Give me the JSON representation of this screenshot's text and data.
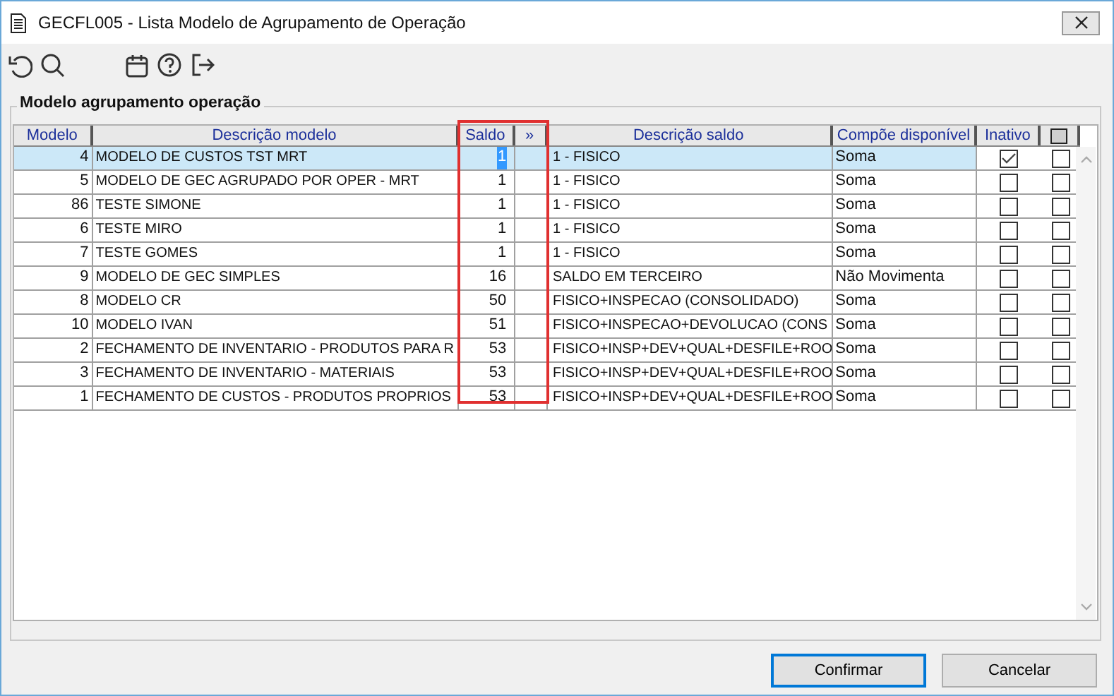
{
  "window": {
    "title": "GECFL005 - Lista Modelo de Agrupamento de Operação"
  },
  "toolbar": [
    {
      "kind": "undo"
    },
    {
      "kind": "search"
    },
    {
      "kind": "spacer"
    },
    {
      "kind": "calendar"
    },
    {
      "kind": "help"
    },
    {
      "kind": "exit"
    }
  ],
  "group": {
    "title": "Modelo agrupamento operação"
  },
  "table": {
    "columns": [
      {
        "label": "Modelo",
        "kind": "text",
        "highlighted": false
      },
      {
        "label": "Descrição modelo",
        "kind": "text",
        "highlighted": false
      },
      {
        "label": "Saldo",
        "kind": "text",
        "highlighted": true
      },
      {
        "label": "»",
        "kind": "text",
        "highlighted": true
      },
      {
        "label": "Descrição saldo",
        "kind": "text",
        "highlighted": false
      },
      {
        "label": "Compõe disponível",
        "kind": "text",
        "highlighted": false
      },
      {
        "label": "Inativo",
        "kind": "check",
        "highlighted": false
      },
      {
        "kind": "checkicon",
        "highlighted": false
      }
    ],
    "rows": [
      {
        "selected": true,
        "modelo": "4",
        "descricao": "MODELO DE CUSTOS TST MRT",
        "saldo": "1",
        "descricao_saldo": "1 - FISICO",
        "compoe": "Soma",
        "inativo": true,
        "column_8": false
      },
      {
        "selected": false,
        "modelo": "5",
        "descricao": "MODELO DE GEC AGRUPADO POR OPER - MRT",
        "saldo": "1",
        "descricao_saldo": "1 - FISICO",
        "compoe": "Soma",
        "inativo": false,
        "column_8": false
      },
      {
        "selected": false,
        "modelo": "86",
        "descricao": "TESTE SIMONE",
        "saldo": "1",
        "descricao_saldo": "1 - FISICO",
        "compoe": "Soma",
        "inativo": false,
        "column_8": false
      },
      {
        "selected": false,
        "modelo": "6",
        "descricao": "TESTE MIRO",
        "saldo": "1",
        "descricao_saldo": "1 - FISICO",
        "compoe": "Soma",
        "inativo": false,
        "column_8": false
      },
      {
        "selected": false,
        "modelo": "7",
        "descricao": "TESTE GOMES",
        "saldo": "1",
        "descricao_saldo": "1 - FISICO",
        "compoe": "Soma",
        "inativo": false,
        "column_8": false
      },
      {
        "selected": false,
        "modelo": "9",
        "descricao": "MODELO DE GEC SIMPLES",
        "saldo": "16",
        "descricao_saldo": "SALDO EM TERCEIRO",
        "compoe": "Não Movimenta",
        "inativo": false,
        "column_8": false
      },
      {
        "selected": false,
        "modelo": "8",
        "descricao": "MODELO CR",
        "saldo": "50",
        "descricao_saldo": "FISICO+INSPECAO (CONSOLIDADO)",
        "compoe": "Soma",
        "inativo": false,
        "column_8": false
      },
      {
        "selected": false,
        "modelo": "10",
        "descricao": "MODELO IVAN",
        "saldo": "51",
        "descricao_saldo": "FISICO+INSPECAO+DEVOLUCAO (CONS",
        "compoe": "Soma",
        "inativo": false,
        "column_8": false
      },
      {
        "selected": false,
        "modelo": "2",
        "descricao": "FECHAMENTO DE INVENTARIO - PRODUTOS PARA R",
        "saldo": "53",
        "descricao_saldo": "FISICO+INSP+DEV+QUAL+DESFILE+ROO",
        "compoe": "Soma",
        "inativo": false,
        "column_8": false
      },
      {
        "selected": false,
        "modelo": "3",
        "descricao": "FECHAMENTO DE INVENTARIO - MATERIAIS",
        "saldo": "53",
        "descricao_saldo": "FISICO+INSP+DEV+QUAL+DESFILE+ROO",
        "compoe": "Soma",
        "inativo": false,
        "column_8": false
      },
      {
        "selected": false,
        "modelo": "1",
        "descricao": "FECHAMENTO DE CUSTOS - PRODUTOS PROPRIOS",
        "saldo": "53",
        "descricao_saldo": "FISICO+INSP+DEV+QUAL+DESFILE+ROO",
        "compoe": "Soma",
        "inativo": false,
        "column_8": false
      }
    ]
  },
  "buttons": [
    {
      "label": "Confirmar",
      "default": true
    },
    {
      "label": "Cancelar",
      "default": false
    }
  ]
}
